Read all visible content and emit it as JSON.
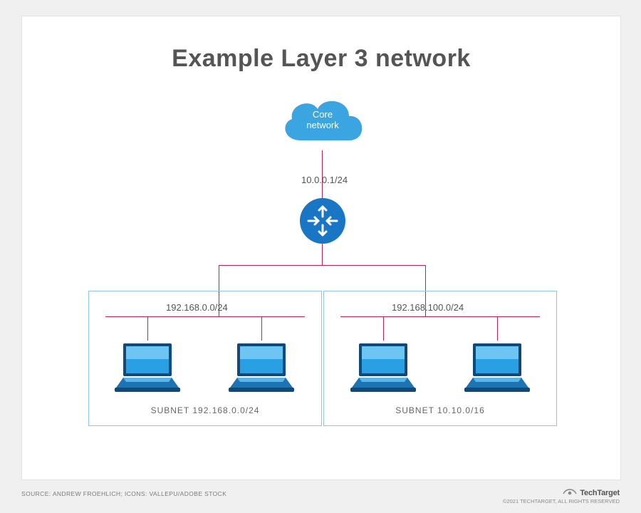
{
  "title": "Example Layer 3 network",
  "core": {
    "cloud_label_line1": "Core",
    "cloud_label_line2": "network",
    "ip": "10.0.0.1/24"
  },
  "router": {
    "icon": "router-icon"
  },
  "subnets": {
    "left": {
      "bus_ip": "192.168.0.0/24",
      "name": "SUBNET 192.168.0.0/24"
    },
    "right": {
      "bus_ip": "192.168.100.0/24",
      "name": "SUBNET 10.10.0/16"
    }
  },
  "footer": {
    "source": "SOURCE: ANDREW FROEHLICH; ICONS: VALLEPU/ADOBE STOCK",
    "brand": "TechTarget",
    "copyright": "©2021 TECHTARGET, ALL RIGHTS RESERVED"
  }
}
